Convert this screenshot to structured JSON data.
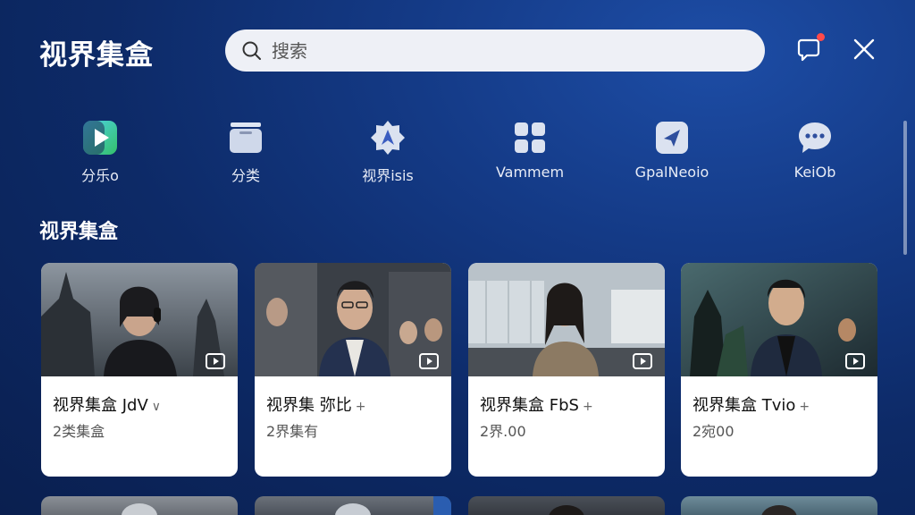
{
  "header": {
    "title": "视界集盒",
    "search_placeholder": "搜索"
  },
  "quick_nav": [
    {
      "label": "分乐o",
      "icon": "play-icon"
    },
    {
      "label": "分类",
      "icon": "folder-icon"
    },
    {
      "label": "视界isis",
      "icon": "compass-icon"
    },
    {
      "label": "Vammem",
      "icon": "grid-icon"
    },
    {
      "label": "GpalNeoio",
      "icon": "navigation-icon"
    },
    {
      "label": "KeiOb",
      "icon": "chat-icon"
    }
  ],
  "section": {
    "title": "视界集盒"
  },
  "cards": [
    {
      "title": "视界集盒 JdV",
      "mark": "∨",
      "subtitle": "2类集盒"
    },
    {
      "title": "视界集  弥比",
      "mark": "+",
      "subtitle": "2界集有"
    },
    {
      "title": "视界集盒 FbS",
      "mark": "+",
      "subtitle": "2界.00"
    },
    {
      "title": "视界集盒 Tvio",
      "mark": "+",
      "subtitle": "2宛00"
    }
  ],
  "colors": {
    "accent": "#1d4da6",
    "background": "#0d2a67",
    "notification_dot": "#ff4a4a"
  }
}
